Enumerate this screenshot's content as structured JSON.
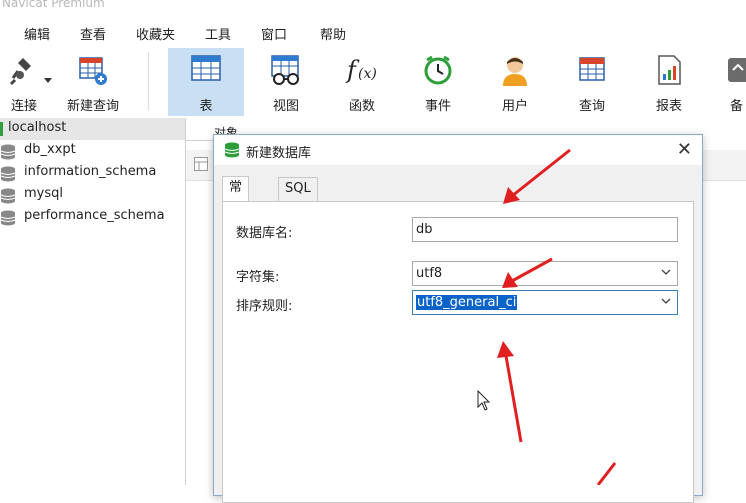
{
  "window": {
    "title": "Navicat Premium"
  },
  "menu": [
    "编辑",
    "查看",
    "收藏夹",
    "工具",
    "窗口",
    "帮助"
  ],
  "toolbar": [
    {
      "label": "连接",
      "icon": "plug-icon"
    },
    {
      "label": "新建查询",
      "icon": "new-query-icon"
    },
    {
      "label": "表",
      "icon": "table-icon",
      "active": true
    },
    {
      "label": "视图",
      "icon": "view-icon"
    },
    {
      "label": "函数",
      "icon": "function-icon"
    },
    {
      "label": "事件",
      "icon": "clock-icon"
    },
    {
      "label": "用户",
      "icon": "user-icon"
    },
    {
      "label": "查询",
      "icon": "query-icon"
    },
    {
      "label": "报表",
      "icon": "report-icon"
    },
    {
      "label": "备",
      "icon": "backup-icon"
    }
  ],
  "sidebar": {
    "connection": "localhost",
    "databases": [
      "db_xxpt",
      "information_schema",
      "mysql",
      "performance_schema"
    ]
  },
  "objects_tab": "对象",
  "dialog": {
    "title": "新建数据库",
    "tabs": [
      "常规",
      "SQL 预览"
    ],
    "fields": {
      "name_label": "数据库名:",
      "name_value": "db",
      "charset_label": "字符集:",
      "charset_value": "utf8",
      "collation_label": "排序规则:",
      "collation_value": "utf8_general_ci"
    }
  },
  "colors": {
    "accent": "#c9dff3",
    "selection": "#0a63c9",
    "annotation_arrow": "#e02020",
    "db_icon": "#2e9e3a"
  }
}
